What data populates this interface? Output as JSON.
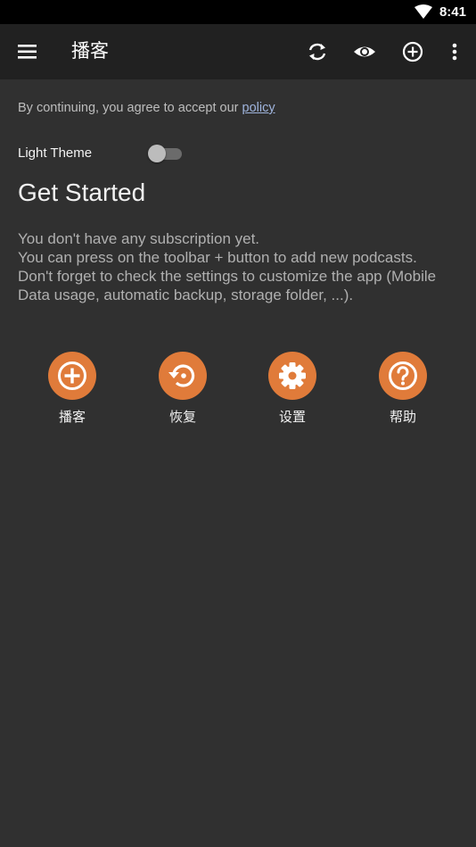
{
  "status_bar": {
    "time": "8:41",
    "wifi_icon": "wifi-icon"
  },
  "toolbar": {
    "title": "播客",
    "icons": [
      "menu-icon",
      "refresh-icon",
      "eye-icon",
      "add-circle-icon",
      "more-vert-icon"
    ]
  },
  "policy": {
    "text": "By continuing, you agree to accept our ",
    "link": "policy"
  },
  "theme": {
    "label": "Light Theme",
    "enabled": false
  },
  "main": {
    "heading": "Get Started",
    "lines": [
      "You don't have any subscription yet.",
      "You can press on the toolbar + button to add new podcasts.",
      "Don't forget to check the settings to customize the app (Mobile",
      "Data usage, automatic backup, storage folder, ...)."
    ]
  },
  "actions": [
    {
      "label": "播客",
      "icon": "add-circle-icon"
    },
    {
      "label": "恢复",
      "icon": "restore-icon"
    },
    {
      "label": "设置",
      "icon": "settings-gear-icon"
    },
    {
      "label": "帮助",
      "icon": "help-circle-icon"
    }
  ],
  "colors": {
    "accent": "#e07b3a",
    "background": "#303030",
    "toolbar": "#212121",
    "status_bar": "#000000"
  }
}
